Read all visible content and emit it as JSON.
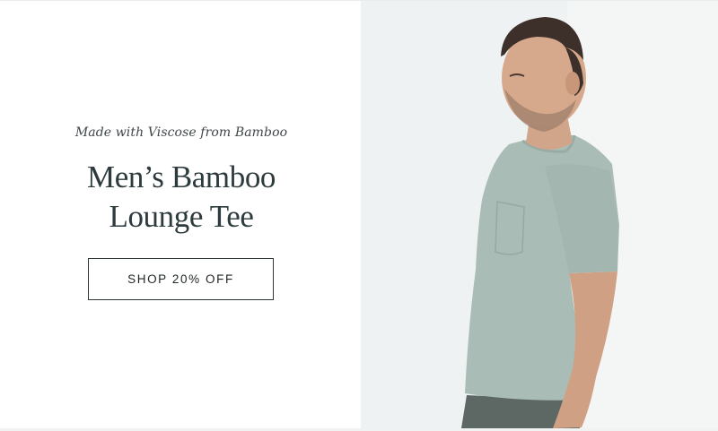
{
  "hero": {
    "eyebrow": "Made with Viscose from Bamboo",
    "title_line1": "Men’s Bamboo",
    "title_line2": "Lounge Tee",
    "cta_label": "SHOP 20% OFF"
  },
  "colors": {
    "heading": "#2e3b3e",
    "tee": "#a9bcb5",
    "photo_background": "#eef2f2"
  }
}
